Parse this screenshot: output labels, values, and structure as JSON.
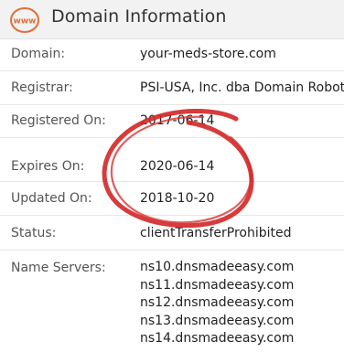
{
  "header": {
    "title": "Domain Information",
    "icon": "www-icon",
    "icon_text": "www",
    "accent_color": "#e0703a"
  },
  "rows": [
    {
      "label": "Domain:",
      "value": "your-meds-store.com"
    },
    {
      "label": "Registrar:",
      "value": "PSI-USA, Inc. dba Domain Robot"
    },
    {
      "label": "Registered On:",
      "value": "2017-06-14"
    },
    {
      "label": "Expires On:",
      "value": "2020-06-14"
    },
    {
      "label": "Updated On:",
      "value": "2018-10-20"
    },
    {
      "label": "Status:",
      "value": "clientTransferProhibited"
    }
  ],
  "name_servers": {
    "label": "Name Servers:",
    "values": [
      "ns10.dnsmadeeasy.com",
      "ns11.dnsmadeeasy.com",
      "ns12.dnsmadeeasy.com",
      "ns13.dnsmadeeasy.com",
      "ns14.dnsmadeeasy.com"
    ]
  },
  "annotation": {
    "type": "hand-drawn-circle",
    "color": "#d42a2a"
  }
}
